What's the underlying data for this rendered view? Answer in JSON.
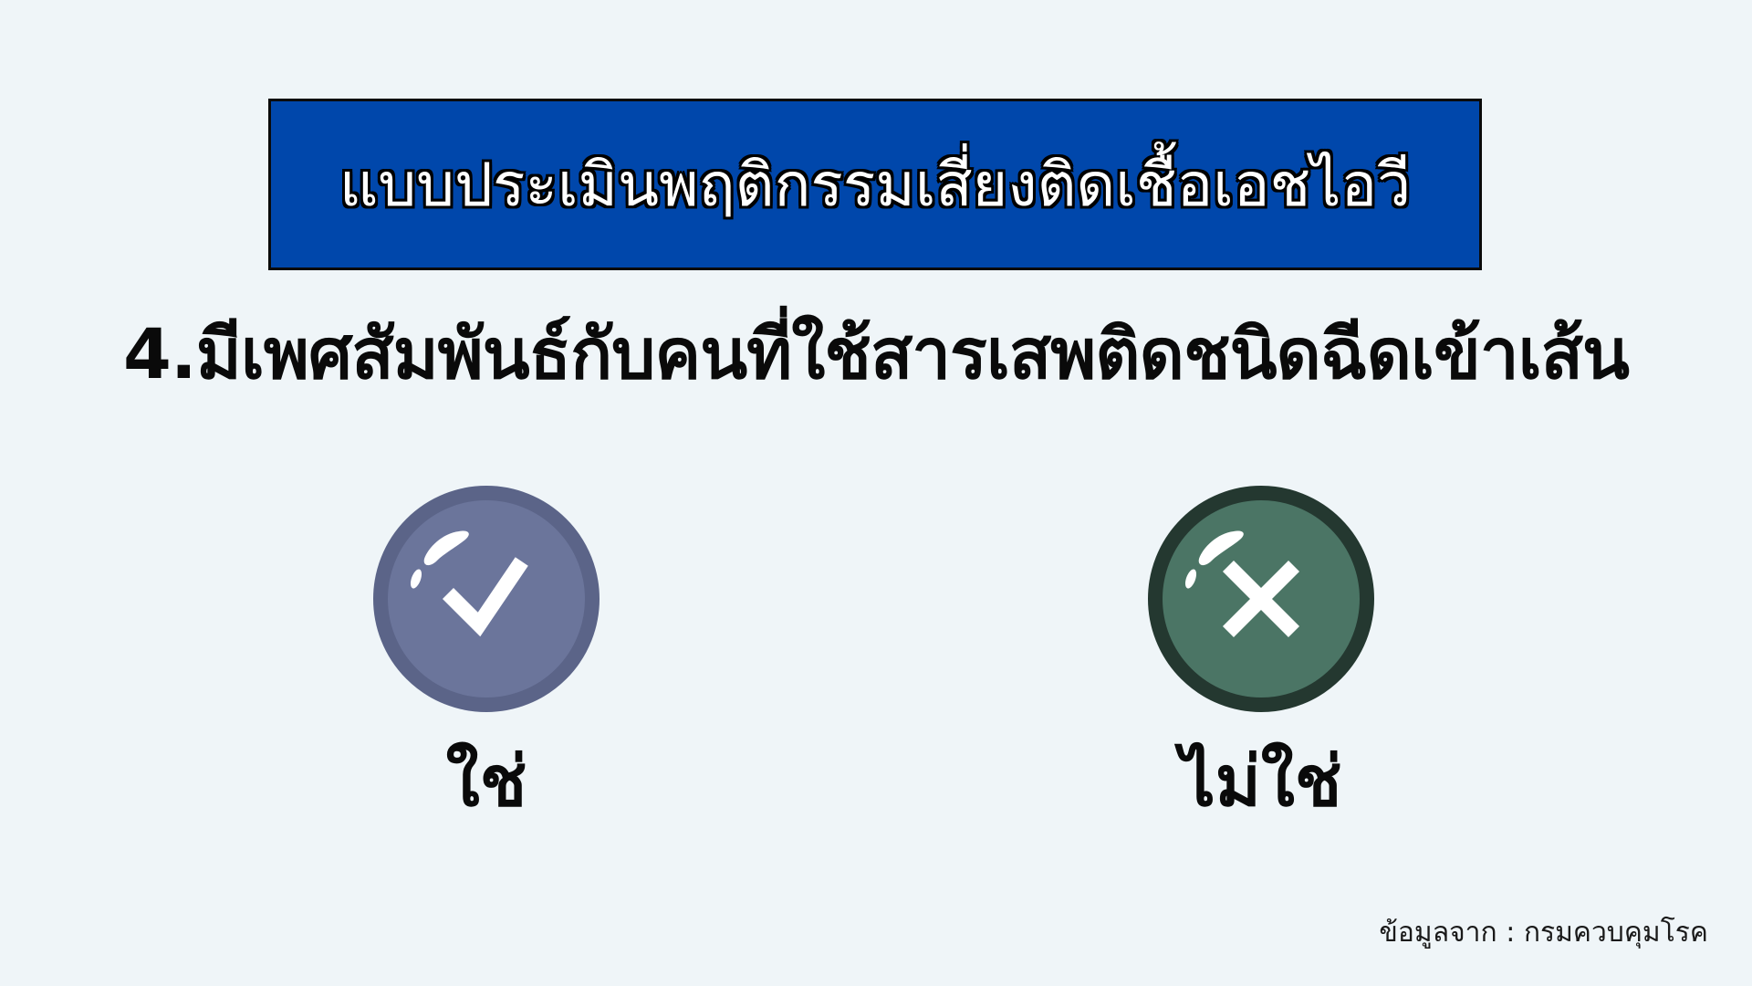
{
  "title": "แบบประเมินพฤติกรรมเสี่ยงติดเชื้อเอชไอวี",
  "question": "4.มีเพศสัมพันธ์กับคนที่ใช้สารเสพติดชนิดฉีดเข้าเส้น",
  "options": [
    {
      "label": "ใช่",
      "icon": "check-icon",
      "color": "#6b759b",
      "ring_color": "#5b6488"
    },
    {
      "label": "ไม่ใช่",
      "icon": "x-icon",
      "color": "#4b7565",
      "ring_color": "#243830"
    }
  ],
  "source": "ข้อมูลจาก : กรมควบคุมโรค",
  "colors": {
    "background": "#eff5f8",
    "title_box": "#0047ab"
  }
}
